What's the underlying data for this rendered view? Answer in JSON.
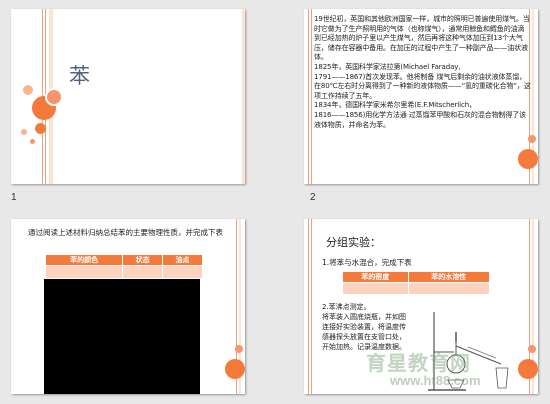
{
  "slides": [
    {
      "number": "1",
      "title": "苯"
    },
    {
      "number": "2",
      "body": "19世纪初，英国和其他欧洲国家一样，城市的照明已普遍使用煤气。当时它做为了生产照明用的气体（也称煤气），通常用鲸鱼和鳕鱼的油滴到已经加热的炉子里以产生煤气，然后再将这种气体加压到13个大气压，储存在容器中备用。在加压的过程中产生了一种副产品——油状液体。\n1825年，英国科学家法拉第(Michael Faraday,\n1791——1867)首次发现苯。他将制备 煤气后剩余的油状液体蒸馏，在80℃左右时分离得到了一种新的液体物质——“氢的重碳化合物”，这项工作持续了五年。\n1834年，德国科学家米希尔里希(E.F.Mitscherlich，\n1816——1856)用化学方法通 过蒸馏苯甲酸和石灰的混合物制得了该液体物质，并命名为苯。"
    },
    {
      "number": "",
      "instruction": "通过阅读上述材料归纳总结苯的主要物理性质，并完成下表",
      "table_headers": [
        "苯的颜色",
        "状态",
        "油点"
      ]
    },
    {
      "number": "",
      "heading": "分组实验：",
      "step1": "1.将苯与水混合，完成下表",
      "table_headers": [
        "苯的密度",
        "苯的水溶性"
      ],
      "step2_lines": [
        "2.苯沸点测定。",
        "将苯装入圆底烧瓶，并如图",
        "连接好实验装置，将温度传",
        "感器探头放置在支管口处，",
        "开始加热。记录温度数据。"
      ],
      "watermark_cn": "育星教育网",
      "watermark_url": "www.ht88.com"
    }
  ]
}
